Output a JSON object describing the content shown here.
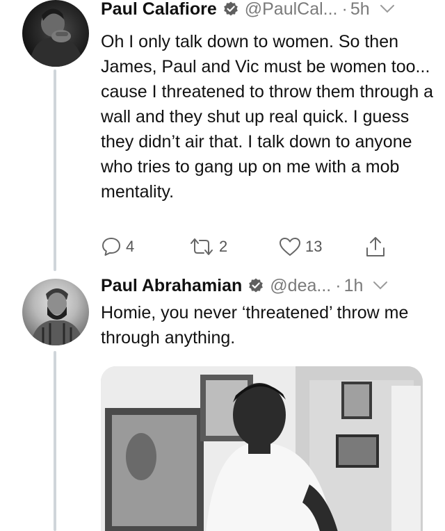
{
  "tweets": [
    {
      "display_name": "Paul Calafiore",
      "handle": "@PaulCal...",
      "separator": "·",
      "time": "5h",
      "text": "Oh I only talk down to women. So then James, Paul and Vic must be women too... cause I threatened to throw them through a wall and they shut up real quick. I guess they didn’t air that. I talk down to anyone who tries to gang up on me with a mob mentality.",
      "actions": {
        "replies": "4",
        "retweets": "2",
        "likes": "13"
      }
    },
    {
      "display_name": "Paul Abrahamian",
      "handle": "@dea...",
      "separator": "·",
      "time": "1h",
      "text": "Homie, you never ‘threatened’ throw me through anything."
    }
  ],
  "icons": {
    "verified": "verified-badge-icon",
    "menu": "chevron-down-icon",
    "reply": "reply-bubble-icon",
    "retweet": "retweet-arrows-icon",
    "like": "heart-icon",
    "share": "share-upload-icon"
  },
  "colors": {
    "text": "#111111",
    "muted": "#7a7a7a",
    "thread_line": "#cfd5da",
    "icon": "#666666"
  }
}
